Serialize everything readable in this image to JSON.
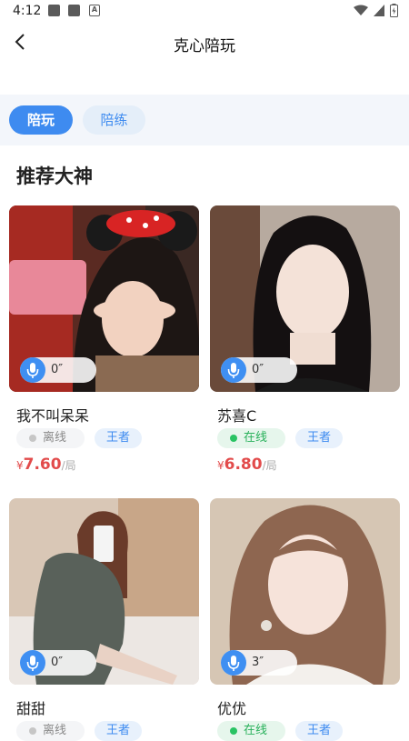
{
  "status_bar": {
    "time": "4:12",
    "a_icon": "A"
  },
  "nav": {
    "title": "克心陪玩"
  },
  "tabs": [
    {
      "label": "陪玩"
    },
    {
      "label": "陪练"
    }
  ],
  "section": {
    "title": "推荐大神"
  },
  "cards": [
    {
      "name": "我不叫呆呆",
      "voice_duration": "0″",
      "status": "离线",
      "game": "王者",
      "currency": "¥",
      "price": "7.60",
      "unit": "/局"
    },
    {
      "name": "苏喜C",
      "voice_duration": "0″",
      "status": "在线",
      "game": "王者",
      "currency": "¥",
      "price": "6.80",
      "unit": "/局"
    },
    {
      "name": "甜甜",
      "voice_duration": "0″",
      "status": "离线",
      "game": "王者"
    },
    {
      "name": "优优",
      "voice_duration": "3″",
      "status": "在线",
      "game": "王者"
    }
  ],
  "colors": {
    "accent": "#3e8bf0",
    "price": "#e24b4b",
    "online": "#29c363",
    "offline": "#c6c6c6"
  }
}
